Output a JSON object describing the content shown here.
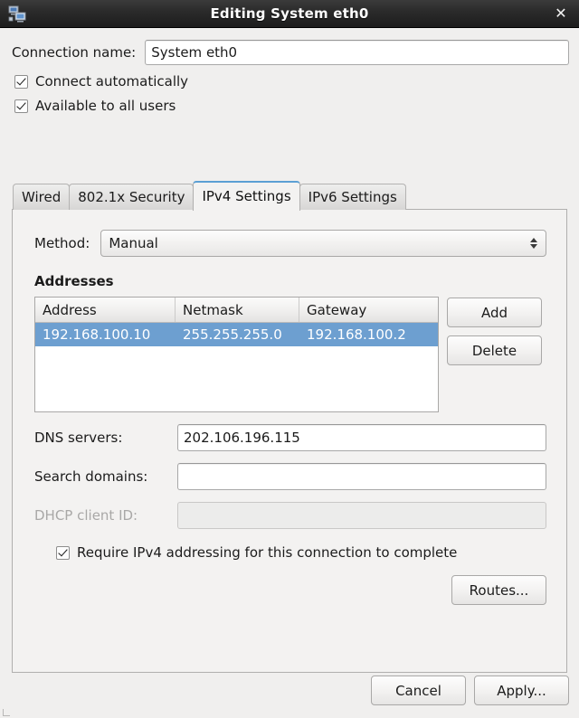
{
  "window": {
    "title": "Editing System eth0",
    "icon": "network-computers-icon",
    "close_label": "✕"
  },
  "connection": {
    "name_label": "Connection name:",
    "name_value": "System eth0",
    "connect_automatically_label": "Connect automatically",
    "connect_automatically_checked": true,
    "available_all_users_label": "Available to all users",
    "available_all_users_checked": true
  },
  "tabs": [
    {
      "label": "Wired",
      "active": false
    },
    {
      "label": "802.1x Security",
      "active": false
    },
    {
      "label": "IPv4 Settings",
      "active": true
    },
    {
      "label": "IPv6 Settings",
      "active": false
    }
  ],
  "ipv4": {
    "method_label": "Method:",
    "method_value": "Manual",
    "addresses_title": "Addresses",
    "table": {
      "columns": [
        "Address",
        "Netmask",
        "Gateway"
      ],
      "rows": [
        [
          "192.168.100.10",
          "255.255.255.0",
          "192.168.100.2"
        ]
      ]
    },
    "add_label": "Add",
    "delete_label": "Delete",
    "dns_label": "DNS servers:",
    "dns_value": "202.106.196.115",
    "search_label": "Search domains:",
    "search_value": "",
    "dhcp_label": "DHCP client ID:",
    "dhcp_value": "",
    "dhcp_disabled": true,
    "require_label": "Require IPv4 addressing for this connection to complete",
    "require_checked": true,
    "routes_label": "Routes..."
  },
  "footer": {
    "cancel_label": "Cancel",
    "apply_label": "Apply..."
  },
  "colors": {
    "titlebar": "#252525",
    "selection": "#6d9fd0",
    "active_tab_accent": "#5b9fd4",
    "background": "#f0efee"
  }
}
